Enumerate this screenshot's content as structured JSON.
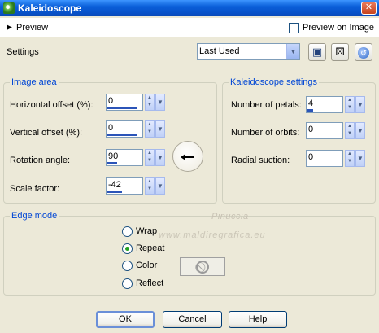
{
  "window": {
    "title": "Kaleidoscope",
    "close_glyph": "✕"
  },
  "preview": {
    "label": "Preview",
    "arrow": "▶",
    "preview_on_image": "Preview on Image",
    "preview_on_image_checked": false
  },
  "settings": {
    "label": "Settings",
    "value": "Last Used",
    "icons": [
      "save-icon",
      "randomize-dice-icon",
      "reset-icon"
    ]
  },
  "image_area": {
    "title": "Image area",
    "fields": [
      {
        "label": "Horizontal offset (%):",
        "value": "0",
        "fill": 0.5
      },
      {
        "label": "Vertical offset (%):",
        "value": "0",
        "fill": 0.5
      },
      {
        "label": "Rotation angle:",
        "value": "90",
        "fill": 0.25
      },
      {
        "label": "Scale factor:",
        "value": "-42",
        "fill": 0.4
      }
    ]
  },
  "kaleidoscope": {
    "title": "Kaleidoscope settings",
    "fields": [
      {
        "label": "Number of petals:",
        "value": "4",
        "fill": 0.15
      },
      {
        "label": "Number of orbits:",
        "value": "0",
        "fill": 0
      },
      {
        "label": "Radial suction:",
        "value": "0",
        "fill": 0
      }
    ]
  },
  "edge_mode": {
    "title": "Edge mode",
    "options": [
      "Wrap",
      "Repeat",
      "Color",
      "Reflect"
    ],
    "selected": "Repeat"
  },
  "watermark": {
    "line1": "Pinuccia",
    "line2": "www.maldiregrafica.eu"
  },
  "buttons": {
    "ok": "OK",
    "cancel": "Cancel",
    "help": "Help"
  },
  "colors": {
    "title_bar": "#0a5fd9",
    "group_title": "#0046d5",
    "dialog_bg": "#ece9d8"
  }
}
